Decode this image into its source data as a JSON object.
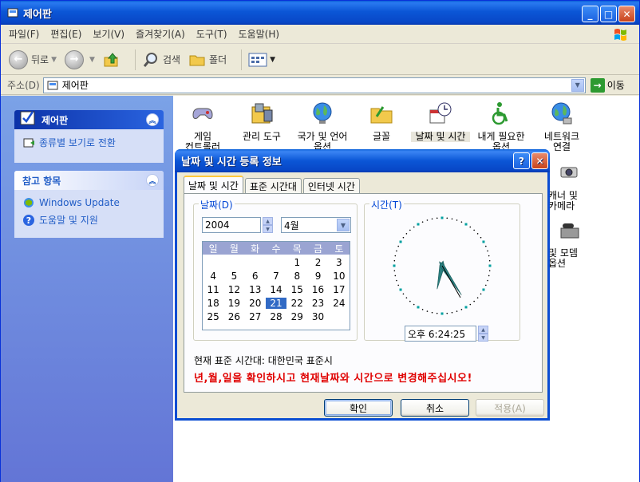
{
  "window": {
    "title": "제어판"
  },
  "menu": [
    "파일(F)",
    "편집(E)",
    "보기(V)",
    "즐겨찾기(A)",
    "도구(T)",
    "도움말(H)"
  ],
  "toolbar": {
    "back": "뒤로",
    "search": "검색",
    "folders": "폴더"
  },
  "address": {
    "label": "주소(D)",
    "value": "제어판",
    "go": "이동"
  },
  "left_panel": {
    "control_panel": {
      "title": "제어판",
      "link": "종류별 보기로 전환"
    },
    "see_also": {
      "title": "참고 항목",
      "links": [
        "Windows Update",
        "도움말 및 지원"
      ]
    }
  },
  "icons": [
    {
      "label": "게임\n컨트롤러"
    },
    {
      "label": "관리 도구"
    },
    {
      "label": "국가 및 언어\n옵션"
    },
    {
      "label": "글꼴"
    },
    {
      "label": "날짜 및 시간"
    },
    {
      "label": "내게 필요한\n옵션"
    },
    {
      "label": "네트워크\n연결"
    }
  ],
  "partial_icons": [
    "캐너 및\n카메라",
    "및 모뎀\n옵션"
  ],
  "dialog": {
    "title": "날짜 및 시간 등록 정보",
    "tabs": [
      "날짜 및 시간",
      "표준 시간대",
      "인터넷 시간"
    ],
    "date_group": "날짜(D)",
    "time_group": "시간(T)",
    "year": "2004",
    "month": "4월",
    "weekdays": [
      "일",
      "월",
      "화",
      "수",
      "목",
      "금",
      "토"
    ],
    "first_weekday_index": 4,
    "days_in_month": 30,
    "selected_day": 21,
    "time": "오후  6:24:25",
    "timezone_text": "현재 표준 시간대: 대한민국 표준시",
    "notice": "년,월,일을 확인하시고 현재날짜와 시간으로 변경해주십시오!",
    "buttons": {
      "ok": "확인",
      "cancel": "취소",
      "apply": "적용(A)"
    }
  }
}
